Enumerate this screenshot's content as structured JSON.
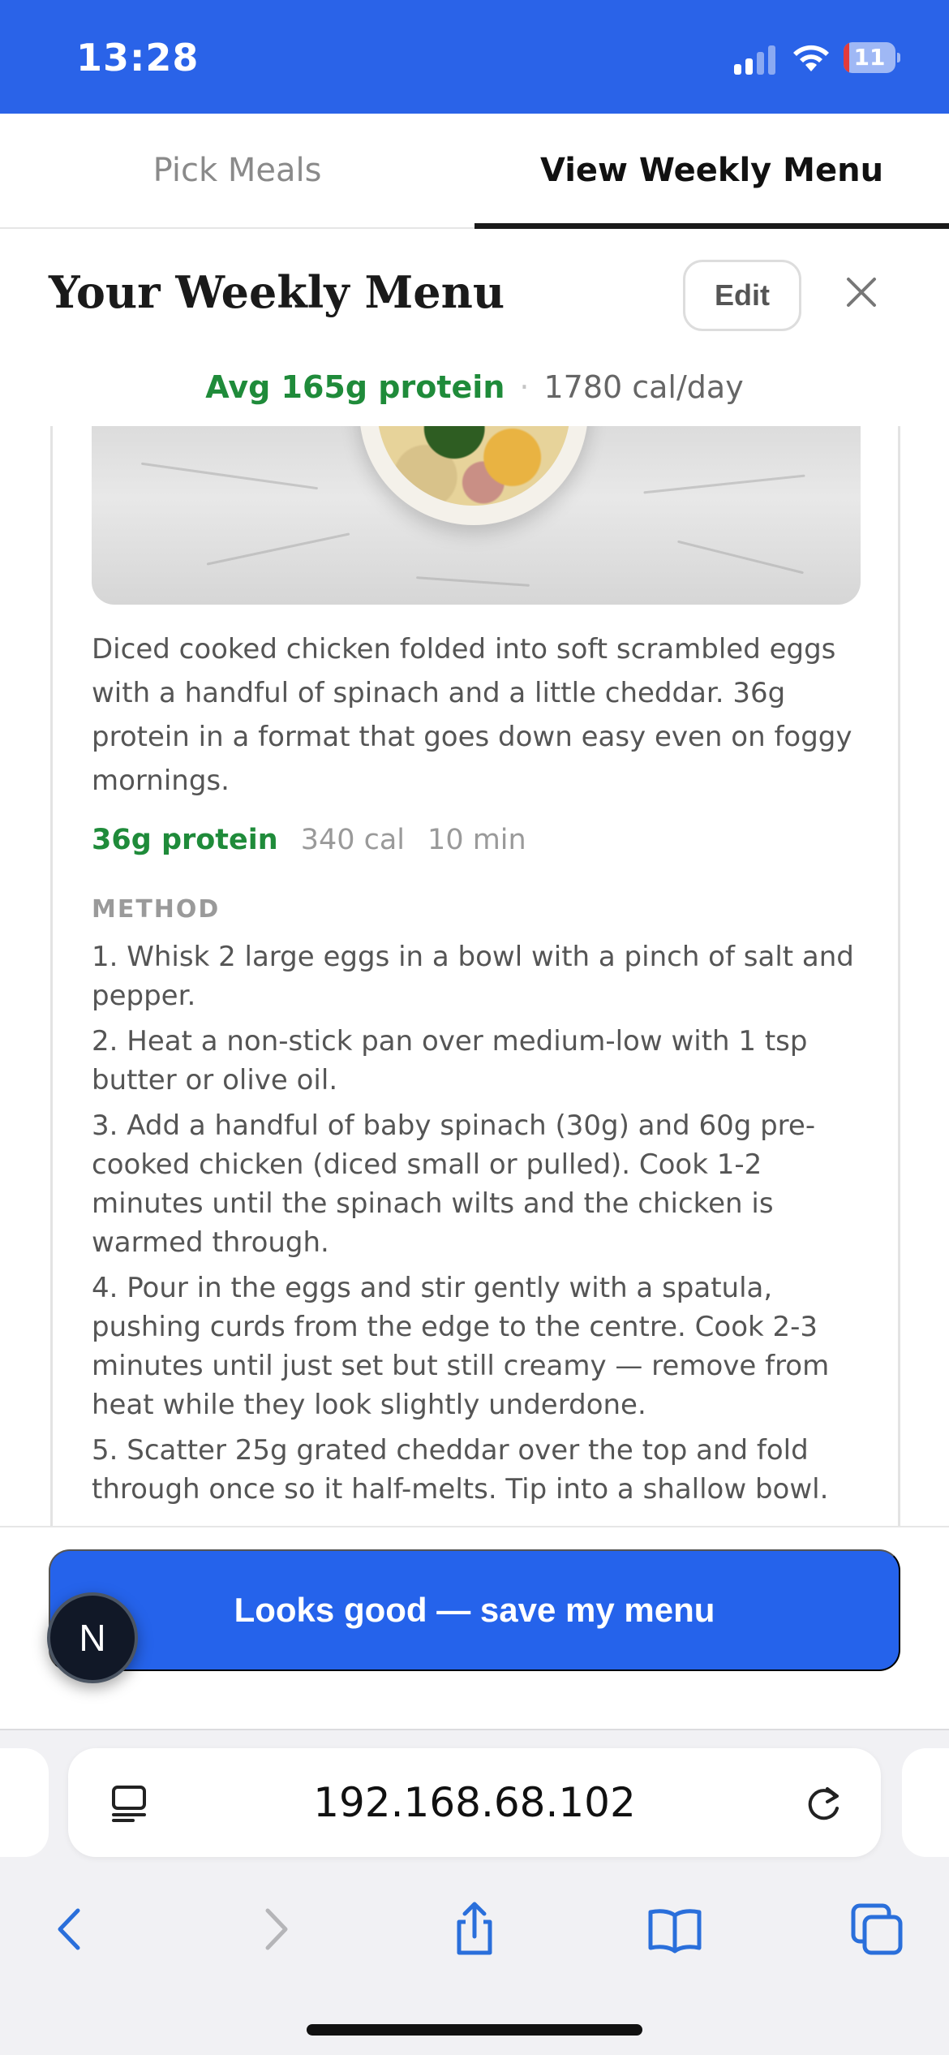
{
  "status_bar": {
    "time": "13:28",
    "battery": "11",
    "battery_level": 0.11
  },
  "tabs": [
    {
      "label": "Pick Meals",
      "active": false
    },
    {
      "label": "View Weekly Menu",
      "active": true
    }
  ],
  "header": {
    "title": "Your Weekly Menu",
    "edit_label": "Edit"
  },
  "summary": {
    "protein": "Avg 165g protein",
    "separator": "·",
    "calories": "1780 cal/day"
  },
  "meal": {
    "description": "Diced cooked chicken folded into soft scrambled eggs with a handful of spinach and a little cheddar. 36g protein in a format that goes down easy even on foggy mornings.",
    "protein": "36g protein",
    "calories": "340 cal",
    "time": "10 min",
    "method_label": "METHOD",
    "steps": [
      "1. Whisk 2 large eggs in a bowl with a pinch of salt and pepper.",
      "2. Heat a non-stick pan over medium-low with 1 tsp butter or olive oil.",
      "3. Add a handful of baby spinach (30g) and 60g pre-cooked chicken (diced small or pulled). Cook 1-2 minutes until the spinach wilts and the chicken is warmed through.",
      "4. Pour in the eggs and stir gently with a spatula, pushing curds from the edge to the centre. Cook 2-3 minutes until just set but still creamy — remove from heat while they look slightly underdone.",
      "5. Scatter 25g grated cheddar over the top and fold through once so it half-melts. Tip into a shallow bowl."
    ]
  },
  "actions": {
    "save_label": "Looks good — save my menu",
    "badge_letter": "N"
  },
  "browser": {
    "url": "192.168.68.102"
  },
  "colors": {
    "accent": "#2563eb",
    "status_bar": "#2a63e8",
    "protein_green": "#1f8b3a",
    "safari_blue": "#2a6fdb"
  }
}
